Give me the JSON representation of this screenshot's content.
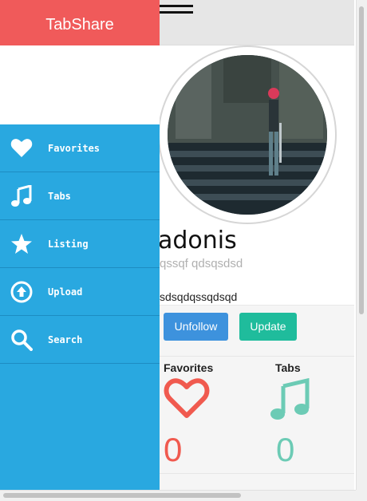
{
  "app": {
    "title": "TabShare"
  },
  "menu": {
    "items": [
      {
        "label": "Favorites",
        "icon": "heart-icon"
      },
      {
        "label": "Tabs",
        "icon": "music-note-icon"
      },
      {
        "label": "Listing",
        "icon": "star-icon"
      },
      {
        "label": "Upload",
        "icon": "upload-icon"
      },
      {
        "label": "Search",
        "icon": "search-icon"
      }
    ]
  },
  "profile": {
    "username": "adonis",
    "subname": "qssqf qdsqsdsd",
    "bio": "sdsqdqssqdsqd",
    "buttons": {
      "unfollow": "Unfollow",
      "update": "Update"
    },
    "stats": {
      "favorites": {
        "label": "Favorites",
        "count": "0",
        "color": "#f05a4f"
      },
      "tabs": {
        "label": "Tabs",
        "count": "0",
        "color": "#6ccbb5"
      }
    }
  },
  "colors": {
    "brand": "#f05a5a",
    "drawer": "#29a8e0",
    "unfollow": "#3d92dd",
    "update": "#1fbc9c"
  }
}
